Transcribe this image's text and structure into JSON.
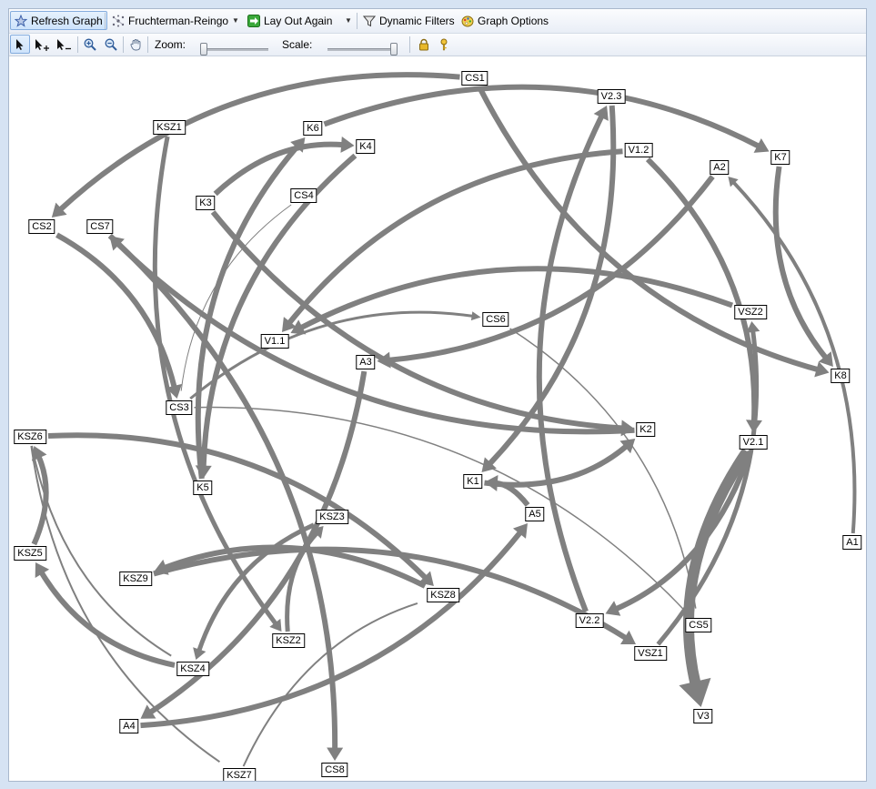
{
  "toolbar": {
    "refresh_label": "Refresh Graph",
    "algorithm_label": "Fruchterman-Reingo",
    "layout_again_label": "Lay Out Again",
    "filters_label": "Dynamic Filters",
    "options_label": "Graph Options",
    "zoom_label": "Zoom:",
    "scale_label": "Scale:",
    "zoom_level": 0.0,
    "scale_level": 1.0
  },
  "icons": {
    "refresh": "refresh-graph-icon",
    "algorithm": "layout-algorithm-icon",
    "layout_again": "layout-again-icon",
    "filters": "filter-funnel-icon",
    "options": "graph-options-icon",
    "select": "select-pointer-icon",
    "add_select": "add-to-selection-icon",
    "remove_select": "remove-from-selection-icon",
    "zoom_in": "zoom-in-icon",
    "zoom_out": "zoom-out-icon",
    "pan": "pan-hand-icon",
    "lock": "lock-icon",
    "help": "key-help-icon"
  },
  "graph": {
    "edge_color": "#808080",
    "nodes": [
      {
        "id": "CS1",
        "label": "CS1"
      },
      {
        "id": "V2.3",
        "label": "V2.3"
      },
      {
        "id": "KSZ1",
        "label": "KSZ1"
      },
      {
        "id": "K6",
        "label": "K6"
      },
      {
        "id": "K4",
        "label": "K4"
      },
      {
        "id": "V1.2",
        "label": "V1.2"
      },
      {
        "id": "K7",
        "label": "K7"
      },
      {
        "id": "A2",
        "label": "A2"
      },
      {
        "id": "CS4",
        "label": "CS4"
      },
      {
        "id": "K3",
        "label": "K3"
      },
      {
        "id": "CS2",
        "label": "CS2"
      },
      {
        "id": "CS7",
        "label": "CS7"
      },
      {
        "id": "VSZ2",
        "label": "VSZ2"
      },
      {
        "id": "CS6",
        "label": "CS6"
      },
      {
        "id": "V1.1",
        "label": "V1.1"
      },
      {
        "id": "A3",
        "label": "A3"
      },
      {
        "id": "K8",
        "label": "K8"
      },
      {
        "id": "CS3",
        "label": "CS3"
      },
      {
        "id": "K2",
        "label": "K2"
      },
      {
        "id": "KSZ6",
        "label": "KSZ6"
      },
      {
        "id": "V2.1",
        "label": "V2.1"
      },
      {
        "id": "K1",
        "label": "K1"
      },
      {
        "id": "K5",
        "label": "K5"
      },
      {
        "id": "A5",
        "label": "A5"
      },
      {
        "id": "KSZ3",
        "label": "KSZ3"
      },
      {
        "id": "A1",
        "label": "A1"
      },
      {
        "id": "KSZ5",
        "label": "KSZ5"
      },
      {
        "id": "KSZ9",
        "label": "KSZ9"
      },
      {
        "id": "KSZ8",
        "label": "KSZ8"
      },
      {
        "id": "V2.2",
        "label": "V2.2"
      },
      {
        "id": "CS5",
        "label": "CS5"
      },
      {
        "id": "KSZ2",
        "label": "KSZ2"
      },
      {
        "id": "VSZ1",
        "label": "VSZ1"
      },
      {
        "id": "KSZ4",
        "label": "KSZ4"
      },
      {
        "id": "V3",
        "label": "V3"
      },
      {
        "id": "A4",
        "label": "A4"
      },
      {
        "id": "CS8",
        "label": "CS8"
      },
      {
        "id": "KSZ7",
        "label": "KSZ7"
      }
    ],
    "edges": [
      {
        "from": "CS1",
        "to": "CS2",
        "weight": 6
      },
      {
        "from": "CS2",
        "to": "CS3",
        "weight": 6
      },
      {
        "from": "CS1",
        "to": "K8",
        "weight": 6
      },
      {
        "from": "K6",
        "to": "K7",
        "weight": 6
      },
      {
        "from": "K7",
        "to": "K8",
        "weight": 6
      },
      {
        "from": "K3",
        "to": "K4",
        "weight": 6
      },
      {
        "from": "K4",
        "to": "K5",
        "weight": 6
      },
      {
        "from": "K5",
        "to": "K6",
        "weight": 6
      },
      {
        "from": "K3",
        "to": "K2",
        "weight": 6
      },
      {
        "from": "K2",
        "to": "CS7",
        "weight": 6
      },
      {
        "from": "K1",
        "to": "K2",
        "weight": 6
      },
      {
        "from": "V2.3",
        "to": "K1",
        "weight": 6
      },
      {
        "from": "A5",
        "to": "K1",
        "weight": 6
      },
      {
        "from": "V2.2",
        "to": "V2.3",
        "weight": 6
      },
      {
        "from": "V1.2",
        "to": "V1.1",
        "weight": 6
      },
      {
        "from": "V1.2",
        "to": "V2.1",
        "weight": 6
      },
      {
        "from": "VSZ2",
        "to": "V1.1",
        "weight": 6
      },
      {
        "from": "A2",
        "to": "A3",
        "weight": 6
      },
      {
        "from": "A1",
        "to": "A2",
        "weight": 4
      },
      {
        "from": "A3",
        "to": "A4",
        "weight": 6
      },
      {
        "from": "A4",
        "to": "A5",
        "weight": 6
      },
      {
        "from": "CS3",
        "to": "CS6",
        "weight": 3
      },
      {
        "from": "KSZ1",
        "to": "KSZ2",
        "weight": 5
      },
      {
        "from": "KSZ2",
        "to": "KSZ3",
        "weight": 5
      },
      {
        "from": "KSZ3",
        "to": "KSZ4",
        "weight": 5
      },
      {
        "from": "KSZ4",
        "to": "KSZ5",
        "weight": 6
      },
      {
        "from": "KSZ5",
        "to": "KSZ6",
        "weight": 6
      },
      {
        "from": "KSZ6",
        "to": "KSZ8",
        "weight": 6
      },
      {
        "from": "KSZ8",
        "to": "KSZ9",
        "weight": 6
      },
      {
        "from": "KSZ9",
        "to": "VSZ1",
        "weight": 6
      },
      {
        "from": "VSZ1",
        "to": "VSZ2",
        "weight": 5
      },
      {
        "from": "V2.1",
        "to": "V2.2",
        "weight": 6
      },
      {
        "from": "V2.1",
        "to": "V3",
        "weight": 12
      },
      {
        "from": "CS7",
        "to": "CS8",
        "weight": 6
      },
      {
        "from": "KSZ6",
        "to": "KSZ7",
        "weight": 2
      },
      {
        "from": "KSZ7",
        "to": "KSZ8",
        "weight": 2
      },
      {
        "from": "KSZ6",
        "to": "KSZ4",
        "weight": 2
      },
      {
        "from": "CS3",
        "to": "CS5",
        "weight": 1.5
      },
      {
        "from": "CS4",
        "to": "CS3",
        "weight": 1
      },
      {
        "from": "CS6",
        "to": "CS5",
        "weight": 1.5
      }
    ]
  }
}
